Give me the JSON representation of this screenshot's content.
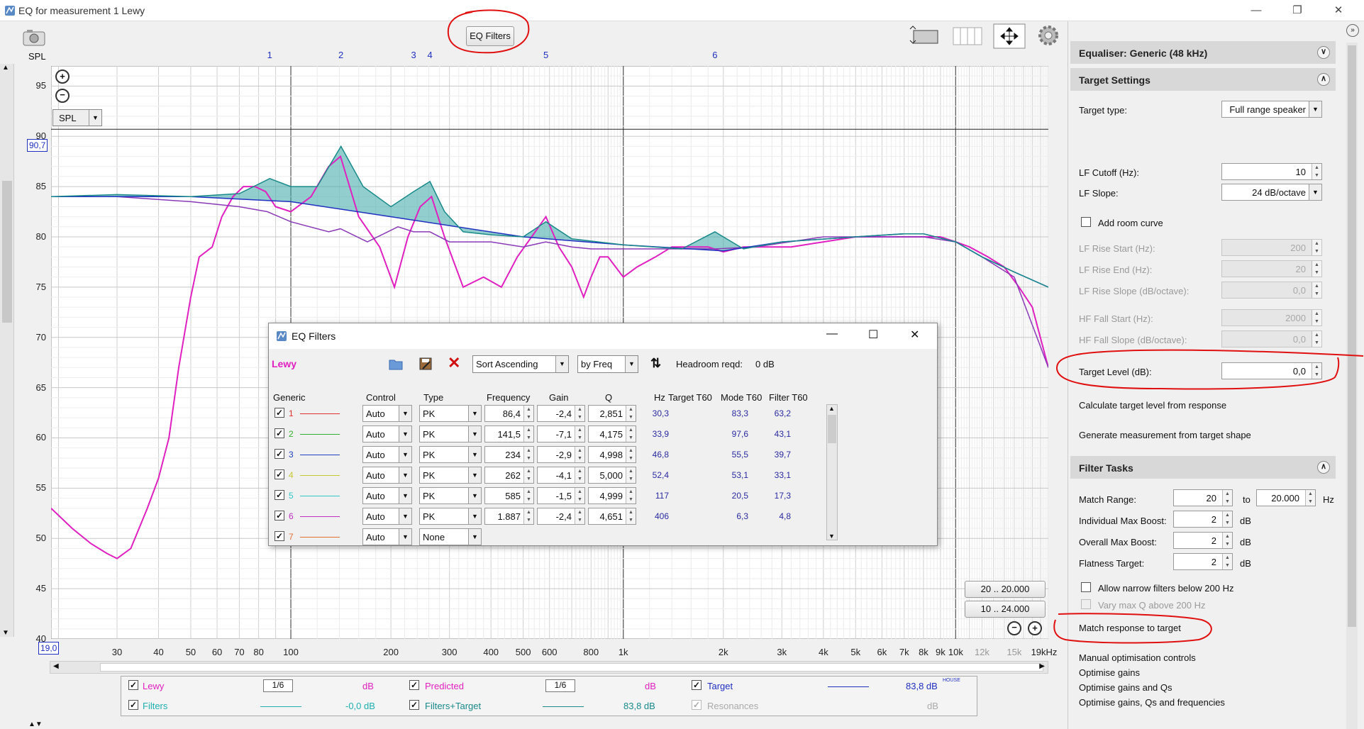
{
  "window": {
    "title": "EQ for measurement 1 Lewy"
  },
  "toolbar": {
    "eq_filters_label": "EQ Filters",
    "spl_label": "SPL"
  },
  "graph": {
    "spl_select": "SPL",
    "cursor_value": "90,7",
    "freq_start": "19,0",
    "y_ticks": [
      "95",
      "90",
      "85",
      "80",
      "75",
      "70",
      "65",
      "60",
      "55",
      "50",
      "45",
      "40"
    ],
    "x_ticks": [
      {
        "t": "30",
        "grey": false
      },
      {
        "t": "40",
        "grey": false
      },
      {
        "t": "50",
        "grey": false
      },
      {
        "t": "60",
        "grey": false
      },
      {
        "t": "70",
        "grey": false
      },
      {
        "t": "80",
        "grey": false
      },
      {
        "t": "100",
        "grey": false
      },
      {
        "t": "200",
        "grey": false
      },
      {
        "t": "300",
        "grey": false
      },
      {
        "t": "400",
        "grey": false
      },
      {
        "t": "500",
        "grey": false
      },
      {
        "t": "600",
        "grey": false
      },
      {
        "t": "800",
        "grey": false
      },
      {
        "t": "1k",
        "grey": false
      },
      {
        "t": "2k",
        "grey": false
      },
      {
        "t": "3k",
        "grey": false
      },
      {
        "t": "4k",
        "grey": false
      },
      {
        "t": "5k",
        "grey": false
      },
      {
        "t": "6k",
        "grey": false
      },
      {
        "t": "7k",
        "grey": false
      },
      {
        "t": "8k",
        "grey": false
      },
      {
        "t": "9k",
        "grey": false
      },
      {
        "t": "10k",
        "grey": false
      },
      {
        "t": "12k",
        "grey": true
      },
      {
        "t": "15k",
        "grey": true
      },
      {
        "t": "19kHz",
        "grey": false
      }
    ],
    "filter_markers": [
      "1",
      "2",
      "3",
      "4",
      "5",
      "6"
    ],
    "range_buttons": [
      "20 .. 20.000",
      "10 .. 24.000"
    ]
  },
  "chart_data": {
    "type": "line",
    "xlabel": "",
    "ylabel": "SPL",
    "xscale": "log",
    "xlim": [
      19,
      19000
    ],
    "ylim": [
      40,
      97
    ],
    "series": [
      {
        "name": "Lewy",
        "color": "#e020c0",
        "x": [
          19,
          22,
          25,
          28,
          30,
          33,
          37,
          40,
          43,
          46,
          50,
          53,
          58,
          62,
          67,
          72,
          78,
          84,
          90,
          100,
          115,
          130,
          141,
          160,
          185,
          205,
          225,
          245,
          265,
          290,
          330,
          380,
          430,
          480,
          530,
          585,
          640,
          700,
          760,
          800,
          850,
          900,
          1000,
          1100,
          1250,
          1400,
          1600,
          1800,
          2000,
          2300,
          2700,
          3200,
          4000,
          5000,
          6000,
          7000,
          8000,
          9000,
          10000,
          11000,
          12500,
          14000,
          15500,
          17000,
          19000
        ],
        "y": [
          53,
          51,
          49.5,
          48.5,
          48,
          49,
          53,
          56,
          60,
          67,
          74,
          78,
          79,
          82,
          84,
          85,
          85,
          84.5,
          83,
          82.5,
          84,
          87,
          88,
          82,
          79,
          75,
          80,
          83,
          84,
          80,
          75,
          76,
          75,
          78,
          80,
          82,
          79,
          77,
          74,
          76,
          78,
          78,
          76,
          77,
          78,
          79,
          79,
          79,
          78.5,
          79,
          79,
          79,
          79.5,
          80,
          80,
          80,
          80,
          80,
          79.5,
          79,
          78,
          77,
          75,
          73,
          67
        ]
      },
      {
        "name": "Predicted",
        "color": "#8a3ab8",
        "x": [
          19,
          30,
          50,
          70,
          85,
          100,
          130,
          141,
          170,
          210,
          234,
          262,
          300,
          400,
          500,
          585,
          700,
          800,
          1000,
          1500,
          1887,
          2500,
          4000,
          6000,
          8000,
          10000,
          12000,
          15000,
          19000
        ],
        "y": [
          84,
          84,
          83.5,
          83,
          82.5,
          81.5,
          80.5,
          80.8,
          79.5,
          81,
          80.5,
          80.5,
          79.5,
          79.5,
          79,
          79.5,
          79,
          78.8,
          78.8,
          78.8,
          78.8,
          79,
          80,
          80,
          80,
          79.5,
          78,
          76,
          67
        ]
      },
      {
        "name": "Target",
        "color": "#2030c0",
        "x": [
          19,
          30,
          50,
          100,
          200,
          500,
          1000,
          2000,
          3000,
          5000,
          7000,
          8000,
          10000,
          12000,
          15000,
          19000
        ],
        "y": [
          84,
          84,
          84,
          83.5,
          82,
          80,
          79.2,
          78.6,
          79.5,
          80,
          80.3,
          80.3,
          79.5,
          78,
          76.5,
          75
        ]
      },
      {
        "name": "Filters+Target",
        "color": "#1a8a8a",
        "x": [
          19,
          30,
          50,
          70,
          86.4,
          100,
          120,
          141.5,
          165,
          200,
          234,
          262,
          290,
          330,
          400,
          500,
          585,
          700,
          1000,
          1500,
          1887,
          2300,
          3000,
          5000,
          7000,
          8000,
          10000,
          12000,
          15000,
          19000
        ],
        "y": [
          84,
          84.2,
          84,
          84.3,
          85.8,
          85,
          85,
          89,
          85,
          83,
          84.5,
          85.5,
          82.5,
          80.5,
          80.2,
          80,
          81.5,
          79.8,
          79.2,
          78.8,
          80.5,
          78.8,
          79.5,
          80,
          80.3,
          80.3,
          79.5,
          78,
          76.5,
          75
        ]
      }
    ]
  },
  "eq_dialog": {
    "title": "EQ Filters",
    "channel": "Lewy",
    "sort": "Sort Ascending",
    "by": "by Freq",
    "headroom_label": "Headroom reqd:",
    "headroom_value": "0 dB",
    "columns": {
      "generic": "Generic",
      "control": "Control",
      "type": "Type",
      "frequency": "Frequency",
      "gain": "Gain",
      "q": "Q",
      "hz": "Hz",
      "target_t60": "Target T60",
      "mode_t60": "Mode T60",
      "filter_t60": "Filter T60"
    },
    "rows": [
      {
        "n": "1",
        "color": "#e03030",
        "control": "Auto",
        "type": "PK",
        "freq": "86,4",
        "gain": "-2,4",
        "q": "2,851",
        "hz": "30,3",
        "mode": "83,3",
        "filt": "63,2"
      },
      {
        "n": "2",
        "color": "#30b030",
        "control": "Auto",
        "type": "PK",
        "freq": "141,5",
        "gain": "-7,1",
        "q": "4,175",
        "hz": "33,9",
        "mode": "97,6",
        "filt": "43,1"
      },
      {
        "n": "3",
        "color": "#2040c0",
        "control": "Auto",
        "type": "PK",
        "freq": "234",
        "gain": "-2,9",
        "q": "4,998",
        "hz": "46,8",
        "mode": "55,5",
        "filt": "39,7"
      },
      {
        "n": "4",
        "color": "#c8c830",
        "control": "Auto",
        "type": "PK",
        "freq": "262",
        "gain": "-4,1",
        "q": "5,000",
        "hz": "52,4",
        "mode": "53,1",
        "filt": "33,1"
      },
      {
        "n": "5",
        "color": "#30c8c8",
        "control": "Auto",
        "type": "PK",
        "freq": "585",
        "gain": "-1,5",
        "q": "4,999",
        "hz": "117",
        "mode": "20,5",
        "filt": "17,3"
      },
      {
        "n": "6",
        "color": "#c030c0",
        "control": "Auto",
        "type": "PK",
        "freq": "1.887",
        "gain": "-2,4",
        "q": "4,651",
        "hz": "406",
        "mode": "6,3",
        "filt": "4,8"
      },
      {
        "n": "7",
        "color": "#e07030",
        "control": "Auto",
        "type": "None",
        "freq": "",
        "gain": "",
        "q": "",
        "hz": "",
        "mode": "",
        "filt": ""
      }
    ]
  },
  "legend": {
    "row1": {
      "lewy": "Lewy",
      "lewy_smooth": "1/6",
      "lewy_db": "dB",
      "predicted": "Predicted",
      "pred_smooth": "1/6",
      "pred_db": "dB",
      "target": "Target",
      "target_db": "83,8 dB",
      "target_sup": "HOUSE"
    },
    "row2": {
      "filters": "Filters",
      "filters_db": "-0,0 dB",
      "ft": "Filters+Target",
      "ft_db": "83,8 dB",
      "res": "Resonances",
      "res_db": "dB"
    }
  },
  "panel": {
    "eq_header": "Equaliser: Generic (48 kHz)",
    "target_header": "Target Settings",
    "target_type_label": "Target type:",
    "target_type": "Full range speaker",
    "lf_cutoff_label": "LF Cutoff (Hz):",
    "lf_cutoff": "10",
    "lf_slope_label": "LF Slope:",
    "lf_slope": "24 dB/octave",
    "add_room_curve": "Add room curve",
    "lf_rise_start_label": "LF Rise Start (Hz):",
    "lf_rise_start": "200",
    "lf_rise_end_label": "LF Rise End (Hz):",
    "lf_rise_end": "20",
    "lf_rise_slope_label": "LF Rise Slope (dB/octave):",
    "lf_rise_slope": "0,0",
    "hf_fall_start_label": "HF Fall Start (Hz):",
    "hf_fall_start": "2000",
    "hf_fall_slope_label": "HF Fall Slope (dB/octave):",
    "hf_fall_slope": "0,0",
    "target_level_label": "Target Level (dB):",
    "target_level": "0,0",
    "calc_target": "Calculate target level from response",
    "gen_meas": "Generate measurement from target shape",
    "filter_tasks_header": "Filter Tasks",
    "match_range_label": "Match Range:",
    "match_from": "20",
    "match_to_label": "to",
    "match_to": "20.000",
    "hz": "Hz",
    "ind_boost_label": "Individual Max Boost:",
    "ind_boost": "2",
    "ov_boost_label": "Overall Max Boost:",
    "ov_boost": "2",
    "flat_label": "Flatness Target:",
    "flat": "2",
    "db": "dB",
    "allow_narrow": "Allow narrow filters below 200 Hz",
    "vary_q": "Vary max Q above 200 Hz",
    "match_btn": "Match response to target",
    "manual": "Manual optimisation controls",
    "opt_gains": "Optimise gains",
    "opt_gains_qs": "Optimise gains and Qs",
    "opt_all": "Optimise gains, Qs and frequencies"
  }
}
